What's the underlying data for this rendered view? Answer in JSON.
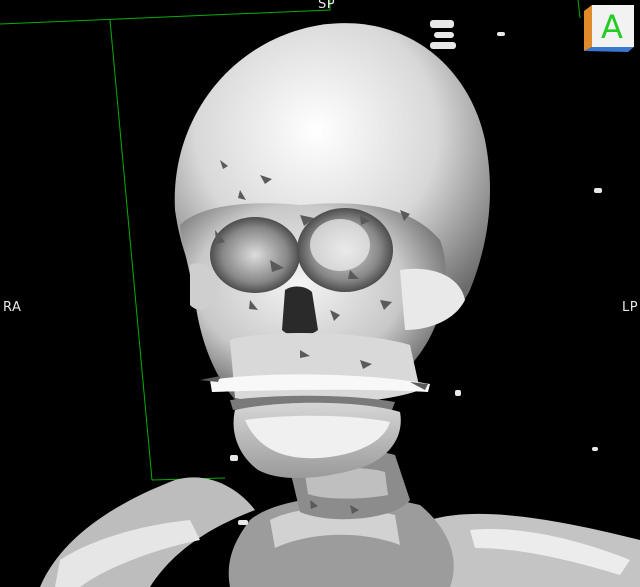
{
  "viewer": {
    "orientation": {
      "top": "SP",
      "left": "RA",
      "right": "LP",
      "cube_face": "A"
    },
    "colors": {
      "background": "#000000",
      "bounding_box": "#00c000",
      "bone": "#dcdcdc",
      "cube_face": "#f2f2f2",
      "cube_letter": "#22cc22",
      "cube_side_orange": "#e08a2a",
      "cube_side_blue": "#3a78d0"
    }
  }
}
